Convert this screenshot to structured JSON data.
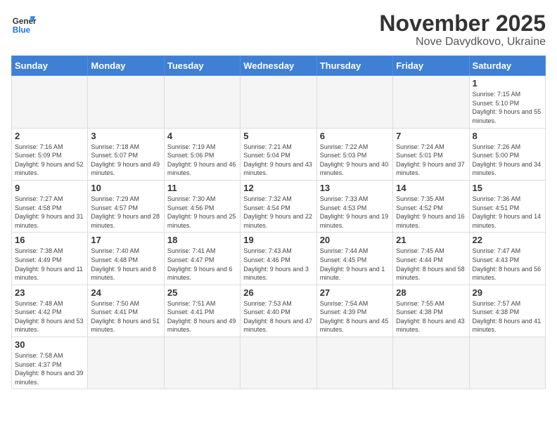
{
  "header": {
    "logo_general": "General",
    "logo_blue": "Blue",
    "month_title": "November 2025",
    "subtitle": "Nove Davydkovo, Ukraine"
  },
  "days_of_week": [
    "Sunday",
    "Monday",
    "Tuesday",
    "Wednesday",
    "Thursday",
    "Friday",
    "Saturday"
  ],
  "weeks": [
    [
      {
        "day": "",
        "info": ""
      },
      {
        "day": "",
        "info": ""
      },
      {
        "day": "",
        "info": ""
      },
      {
        "day": "",
        "info": ""
      },
      {
        "day": "",
        "info": ""
      },
      {
        "day": "",
        "info": ""
      },
      {
        "day": "1",
        "info": "Sunrise: 7:15 AM\nSunset: 5:10 PM\nDaylight: 9 hours and 55 minutes."
      }
    ],
    [
      {
        "day": "2",
        "info": "Sunrise: 7:16 AM\nSunset: 5:09 PM\nDaylight: 9 hours and 52 minutes."
      },
      {
        "day": "3",
        "info": "Sunrise: 7:18 AM\nSunset: 5:07 PM\nDaylight: 9 hours and 49 minutes."
      },
      {
        "day": "4",
        "info": "Sunrise: 7:19 AM\nSunset: 5:06 PM\nDaylight: 9 hours and 46 minutes."
      },
      {
        "day": "5",
        "info": "Sunrise: 7:21 AM\nSunset: 5:04 PM\nDaylight: 9 hours and 43 minutes."
      },
      {
        "day": "6",
        "info": "Sunrise: 7:22 AM\nSunset: 5:03 PM\nDaylight: 9 hours and 40 minutes."
      },
      {
        "day": "7",
        "info": "Sunrise: 7:24 AM\nSunset: 5:01 PM\nDaylight: 9 hours and 37 minutes."
      },
      {
        "day": "8",
        "info": "Sunrise: 7:26 AM\nSunset: 5:00 PM\nDaylight: 9 hours and 34 minutes."
      }
    ],
    [
      {
        "day": "9",
        "info": "Sunrise: 7:27 AM\nSunset: 4:58 PM\nDaylight: 9 hours and 31 minutes."
      },
      {
        "day": "10",
        "info": "Sunrise: 7:29 AM\nSunset: 4:57 PM\nDaylight: 9 hours and 28 minutes."
      },
      {
        "day": "11",
        "info": "Sunrise: 7:30 AM\nSunset: 4:56 PM\nDaylight: 9 hours and 25 minutes."
      },
      {
        "day": "12",
        "info": "Sunrise: 7:32 AM\nSunset: 4:54 PM\nDaylight: 9 hours and 22 minutes."
      },
      {
        "day": "13",
        "info": "Sunrise: 7:33 AM\nSunset: 4:53 PM\nDaylight: 9 hours and 19 minutes."
      },
      {
        "day": "14",
        "info": "Sunrise: 7:35 AM\nSunset: 4:52 PM\nDaylight: 9 hours and 16 minutes."
      },
      {
        "day": "15",
        "info": "Sunrise: 7:36 AM\nSunset: 4:51 PM\nDaylight: 9 hours and 14 minutes."
      }
    ],
    [
      {
        "day": "16",
        "info": "Sunrise: 7:38 AM\nSunset: 4:49 PM\nDaylight: 9 hours and 11 minutes."
      },
      {
        "day": "17",
        "info": "Sunrise: 7:40 AM\nSunset: 4:48 PM\nDaylight: 9 hours and 8 minutes."
      },
      {
        "day": "18",
        "info": "Sunrise: 7:41 AM\nSunset: 4:47 PM\nDaylight: 9 hours and 6 minutes."
      },
      {
        "day": "19",
        "info": "Sunrise: 7:43 AM\nSunset: 4:46 PM\nDaylight: 9 hours and 3 minutes."
      },
      {
        "day": "20",
        "info": "Sunrise: 7:44 AM\nSunset: 4:45 PM\nDaylight: 9 hours and 1 minute."
      },
      {
        "day": "21",
        "info": "Sunrise: 7:45 AM\nSunset: 4:44 PM\nDaylight: 8 hours and 58 minutes."
      },
      {
        "day": "22",
        "info": "Sunrise: 7:47 AM\nSunset: 4:43 PM\nDaylight: 8 hours and 56 minutes."
      }
    ],
    [
      {
        "day": "23",
        "info": "Sunrise: 7:48 AM\nSunset: 4:42 PM\nDaylight: 8 hours and 53 minutes."
      },
      {
        "day": "24",
        "info": "Sunrise: 7:50 AM\nSunset: 4:41 PM\nDaylight: 8 hours and 51 minutes."
      },
      {
        "day": "25",
        "info": "Sunrise: 7:51 AM\nSunset: 4:41 PM\nDaylight: 8 hours and 49 minutes."
      },
      {
        "day": "26",
        "info": "Sunrise: 7:53 AM\nSunset: 4:40 PM\nDaylight: 8 hours and 47 minutes."
      },
      {
        "day": "27",
        "info": "Sunrise: 7:54 AM\nSunset: 4:39 PM\nDaylight: 8 hours and 45 minutes."
      },
      {
        "day": "28",
        "info": "Sunrise: 7:55 AM\nSunset: 4:38 PM\nDaylight: 8 hours and 43 minutes."
      },
      {
        "day": "29",
        "info": "Sunrise: 7:57 AM\nSunset: 4:38 PM\nDaylight: 8 hours and 41 minutes."
      }
    ],
    [
      {
        "day": "30",
        "info": "Sunrise: 7:58 AM\nSunset: 4:37 PM\nDaylight: 8 hours and 39 minutes."
      },
      {
        "day": "",
        "info": ""
      },
      {
        "day": "",
        "info": ""
      },
      {
        "day": "",
        "info": ""
      },
      {
        "day": "",
        "info": ""
      },
      {
        "day": "",
        "info": ""
      },
      {
        "day": "",
        "info": ""
      }
    ]
  ]
}
